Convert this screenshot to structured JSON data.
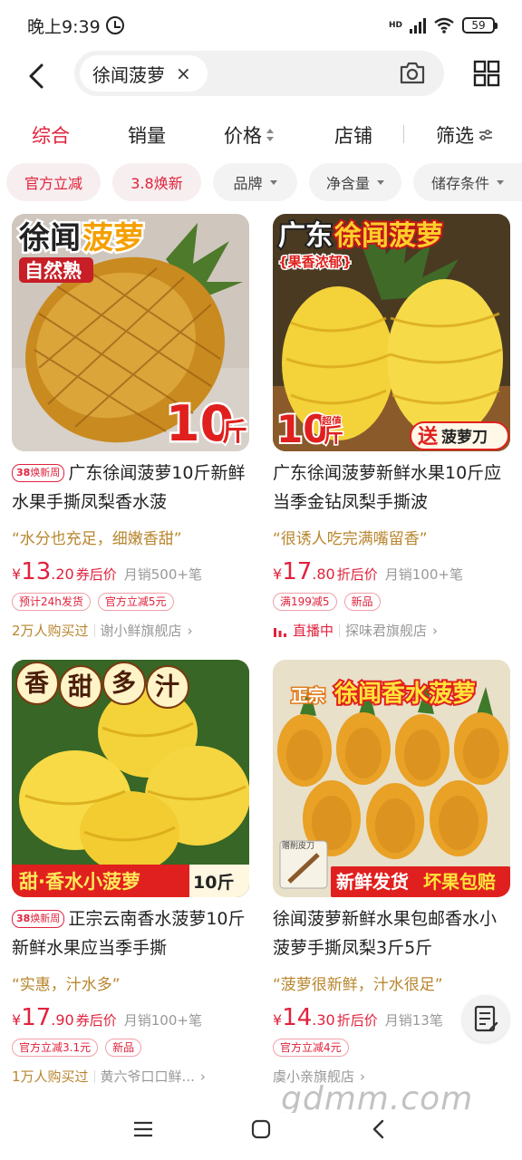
{
  "status_bar": {
    "time": "晚上9:39",
    "network_label": "HD",
    "battery": "59"
  },
  "search": {
    "query": "徐闻菠萝",
    "clear_symbol": "×"
  },
  "sort_tabs": [
    {
      "label": "综合",
      "active": true
    },
    {
      "label": "销量"
    },
    {
      "label": "价格"
    },
    {
      "label": "店铺"
    },
    {
      "label": "筛选"
    }
  ],
  "filters": [
    "官方立减",
    "3.8焕新",
    "品牌",
    "净含量",
    "储存条件"
  ],
  "products": [
    {
      "image": {
        "headline_a": "徐闻",
        "headline_b": "菠萝",
        "badge": "自然熟",
        "weight": "10",
        "unit": "斤"
      },
      "tag": {
        "num": "38",
        "text": "焕新周"
      },
      "title": "广东徐闻菠萝10斤新鲜水果手撕凤梨香水菠",
      "quote": "“水分也充足，细嫩香甜”",
      "price": {
        "yen": "¥",
        "int": "13",
        "dec": ".20",
        "label": "券后价"
      },
      "sales": "月销500+笔",
      "promos": [
        "预计24h发货",
        "官方立减5元"
      ],
      "highlight": "2万人购买过",
      "shop": "谢小鲜旗舰店",
      "shop_arrow": "›"
    },
    {
      "image": {
        "headline_a": "广东",
        "headline_b": "徐闻菠萝",
        "badge": "{果香浓郁}",
        "weight": "10",
        "unit": "斤",
        "small": "超值",
        "gift_a": "送",
        "gift_b": "菠萝刀"
      },
      "title": "广东徐闻菠萝新鲜水果10斤应当季金钻凤梨手撕波",
      "quote": "“很诱人吃完满嘴留香”",
      "price": {
        "yen": "¥",
        "int": "17",
        "dec": ".80",
        "label": "折后价"
      },
      "sales": "月销100+笔",
      "promos": [
        "满199减5",
        "新品"
      ],
      "live": "直播中",
      "shop": "探味君旗舰店",
      "shop_arrow": "›"
    },
    {
      "image": {
        "chars": [
          "香",
          "甜",
          "多",
          "汁"
        ],
        "banner": "甜·香水小菠萝",
        "weight": "10斤"
      },
      "tag": {
        "num": "38",
        "text": "焕新周"
      },
      "title": "正宗云南香水菠萝10斤新鲜水果应当季手撕",
      "quote": "“实惠，汁水多”",
      "price": {
        "yen": "¥",
        "int": "17",
        "dec": ".90",
        "label": "券后价"
      },
      "sales": "月销100+笔",
      "promos": [
        "官方立减3.1元",
        "新品"
      ],
      "highlight": "1万人购买过",
      "shop": "黄六爷口口鲜...",
      "shop_arrow": "›"
    },
    {
      "image": {
        "headline_a": "正宗",
        "headline_b": "徐闻香水菠萝",
        "gift": "赠削皮刀",
        "banner_a": "新鲜发货",
        "banner_b": "坏果包赔"
      },
      "title": "徐闻菠萝新鲜水果包邮香水小菠萝手撕凤梨3斤5斤",
      "quote": "“菠萝很新鲜，汁水很足”",
      "price": {
        "yen": "¥",
        "int": "14",
        "dec": ".30",
        "label": "折后价"
      },
      "sales": "月销13笔",
      "promos": [
        "官方立减4元"
      ],
      "shop": "虞小亲旗舰店",
      "shop_arrow": "›"
    }
  ],
  "watermark": "gdmm.com",
  "colors": {
    "accent": "#e0223c",
    "quote": "#b8862e",
    "muted": "#999999"
  }
}
